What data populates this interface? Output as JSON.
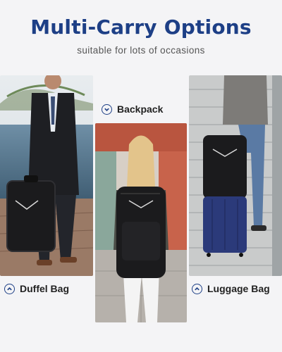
{
  "header": {
    "title": "Multi-Carry Options",
    "subtitle": "suitable for lots of occasions"
  },
  "options": {
    "backpack": {
      "label": "Backpack",
      "icon": "chevron-down-circle-icon"
    },
    "duffel": {
      "label": "Duffel Bag",
      "icon": "chevron-up-circle-icon"
    },
    "luggage": {
      "label": "Luggage Bag",
      "icon": "chevron-up-circle-icon"
    }
  },
  "colors": {
    "title": "#1d3f86",
    "accent": "#1d3f86",
    "bag": "#1b1b1d",
    "suitcase": "#2b3a7a"
  }
}
